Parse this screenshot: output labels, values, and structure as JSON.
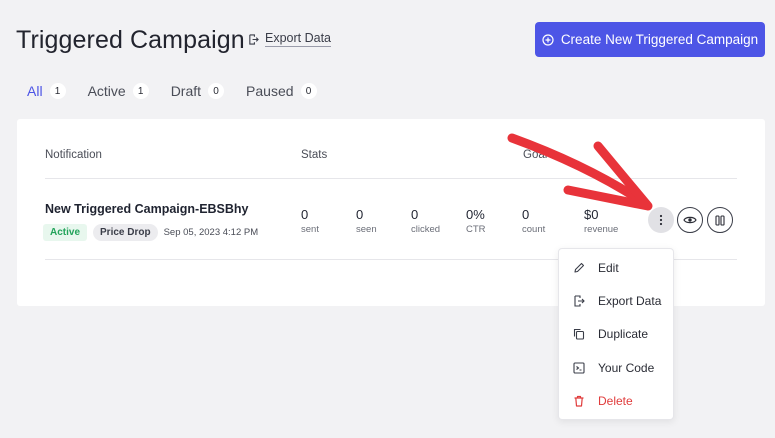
{
  "header": {
    "title": "Triggered Campaign",
    "export_label": "Export Data",
    "create_label": "Create New Triggered Campaign"
  },
  "tabs": [
    {
      "label": "All",
      "count": "1",
      "active": true
    },
    {
      "label": "Active",
      "count": "1"
    },
    {
      "label": "Draft",
      "count": "0"
    },
    {
      "label": "Paused",
      "count": "0"
    }
  ],
  "table": {
    "columns": {
      "notification": "Notification",
      "stats": "Stats",
      "goal": "Goal"
    },
    "row": {
      "title": "New Triggered Campaign-EBSBhy",
      "status": "Active",
      "type": "Price Drop",
      "timestamp": "Sep 05, 2023 4:12 PM",
      "stats": [
        {
          "value": "0",
          "label": "sent"
        },
        {
          "value": "0",
          "label": "seen"
        },
        {
          "value": "0",
          "label": "clicked"
        },
        {
          "value": "0%",
          "label": "CTR"
        },
        {
          "value": "0",
          "label": "count"
        },
        {
          "value": "$0",
          "label": "revenue"
        }
      ]
    }
  },
  "menu": {
    "items": [
      {
        "label": "Edit",
        "icon": "pencil-icon"
      },
      {
        "label": "Export Data",
        "icon": "export-icon"
      },
      {
        "label": "Duplicate",
        "icon": "copy-icon"
      },
      {
        "label": "Your Code",
        "icon": "terminal-icon"
      },
      {
        "label": "Delete",
        "icon": "trash-icon"
      }
    ]
  },
  "colors": {
    "accent": "#4d55e6",
    "active_green": "#22a35a",
    "danger": "#e03b3b",
    "annotation_arrow": "#e8333a"
  }
}
